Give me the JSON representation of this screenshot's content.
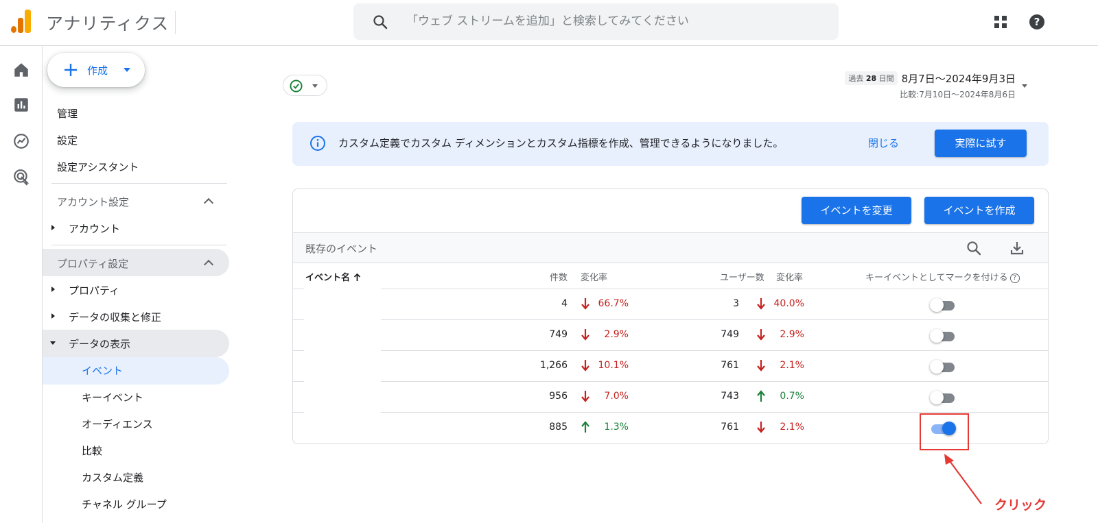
{
  "header": {
    "app_title": "アナリティクス",
    "search_placeholder": "「ウェブ ストリームを追加」と検索してみてください",
    "brand_colors": [
      "#f9ab00",
      "#e37400"
    ]
  },
  "rail": {
    "icons": [
      "home-icon",
      "reports-icon",
      "explore-icon",
      "advertising-icon"
    ]
  },
  "nav": {
    "create_label": "作成",
    "top_items": [
      "管理",
      "設定",
      "設定アシスタント"
    ],
    "account_section": "アカウント設定",
    "account_item": "アカウント",
    "property_section": "プロパティ設定",
    "property_items": [
      "プロパティ",
      "データの収集と修正"
    ],
    "data_display": "データの表示",
    "data_display_children": [
      "イベント",
      "キーイベント",
      "オーディエンス",
      "比較",
      "カスタム定義",
      "チャネル グループ"
    ],
    "active_item": "イベント"
  },
  "date_range": {
    "badge_prefix": "過去",
    "badge_days": "28",
    "badge_suffix": "日間",
    "range": "8月7日〜2024年9月3日",
    "compare": "比較:7月10日〜2024年8月6日"
  },
  "banner": {
    "message": "カスタム定義でカスタム ディメンションとカスタム指標を作成、管理できるようになりました。",
    "close_label": "閉じる",
    "try_label": "実際に試す"
  },
  "events_card": {
    "modify_label": "イベントを変更",
    "create_label": "イベントを作成",
    "title": "既存のイベント",
    "columns": {
      "name": "イベント名",
      "count": "件数",
      "count_change": "変化率",
      "users": "ユーザー数",
      "users_change": "変化率",
      "mark_key": "キーイベントとしてマークを付ける",
      "help": "?"
    },
    "rows": [
      {
        "count": "4",
        "count_change": "66.7%",
        "count_dir": "down",
        "users": "3",
        "users_change": "40.0%",
        "users_dir": "down",
        "key_event": false
      },
      {
        "count": "749",
        "count_change": "2.9%",
        "count_dir": "down",
        "users": "749",
        "users_change": "2.9%",
        "users_dir": "down",
        "key_event": false
      },
      {
        "count": "1,266",
        "count_change": "10.1%",
        "count_dir": "down",
        "users": "761",
        "users_change": "2.1%",
        "users_dir": "down",
        "key_event": false
      },
      {
        "count": "956",
        "count_change": "7.0%",
        "count_dir": "down",
        "users": "743",
        "users_change": "0.7%",
        "users_dir": "up",
        "key_event": false
      },
      {
        "count": "885",
        "count_change": "1.3%",
        "count_dir": "up",
        "users": "761",
        "users_change": "2.1%",
        "users_dir": "down",
        "key_event": true
      }
    ]
  },
  "annotation": {
    "label": "クリック",
    "color": "#e53935"
  }
}
